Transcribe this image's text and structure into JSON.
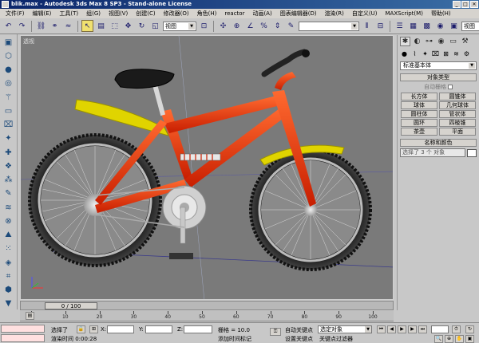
{
  "window": {
    "title": "blik.max - Autodesk 3ds Max 8 SP3 - Stand-alone License",
    "min_glyph": "_",
    "max_glyph": "□",
    "close_glyph": "✕"
  },
  "menu": [
    "文件(F)",
    "编辑(E)",
    "工具(T)",
    "组(G)",
    "视图(V)",
    "创建(C)",
    "修改器(O)",
    "角色(H)",
    "reactor",
    "动画(A)",
    "图表编辑器(D)",
    "渲染(R)",
    "自定义(U)",
    "MAXScript(M)",
    "帮助(H)"
  ],
  "toolbar": {
    "view_select": "视图",
    "named_select": "",
    "right_view_select": "视图"
  },
  "viewport": {
    "label": "透视",
    "background": "#7a7a7a"
  },
  "timeline": {
    "frame_display": "0 / 100"
  },
  "ruler": {
    "ticks": [
      "0",
      "10",
      "20",
      "30",
      "40",
      "50",
      "60",
      "70",
      "80",
      "90",
      "100"
    ]
  },
  "command_panel": {
    "category_select": "标准基本体",
    "object_type_header": "对象类型",
    "autogrid_label": "自动栅格",
    "objects": [
      "长方体",
      "圆锥体",
      "球体",
      "几何球体",
      "圆柱体",
      "管状体",
      "圆环",
      "四棱锥",
      "茶壶",
      "平面"
    ],
    "name_color_header": "名称和颜色",
    "name_field": "选择了 3 个 对象"
  },
  "statusbar": {
    "selection_label": "选择了",
    "x_label": "X:",
    "y_label": "Y:",
    "z_label": "Z:",
    "grid_label": "栅格 = 10.0",
    "auto_key_label": "自动关键点",
    "auto_key_select": "选定对象",
    "set_key_label": "设置关键点",
    "key_filters_label": "关键点过滤器",
    "add_time_tag": "添加时间标记",
    "render_time": "渲染时间 0:00:28"
  }
}
